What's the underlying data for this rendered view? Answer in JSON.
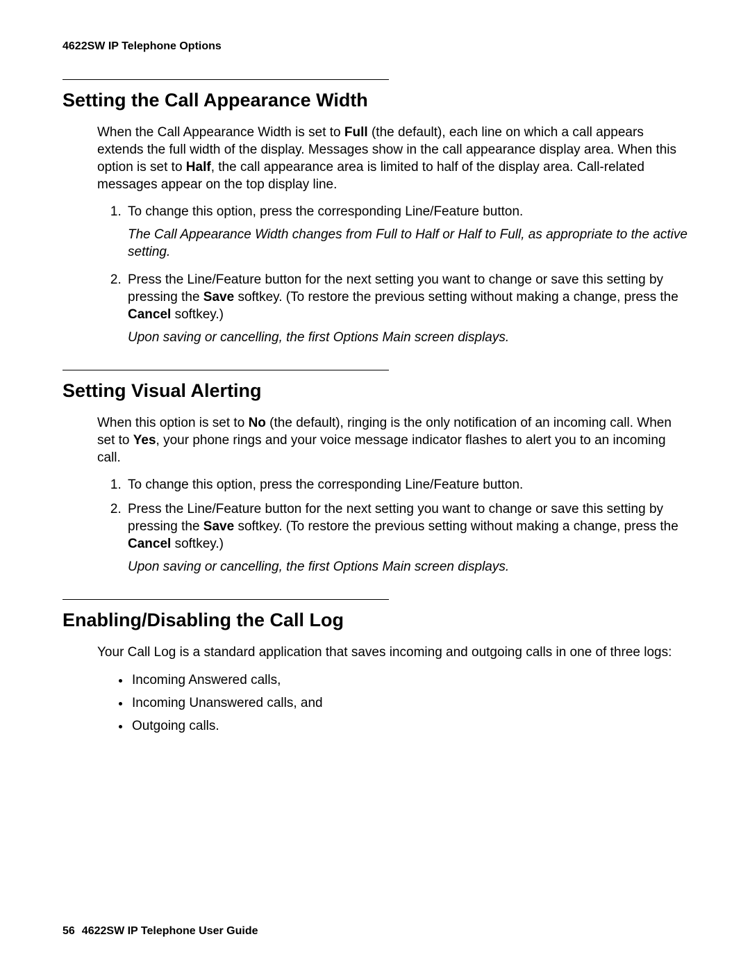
{
  "header": {
    "running": "4622SW IP Telephone Options"
  },
  "sections": {
    "s1": {
      "heading": "Setting the Call Appearance Width",
      "intro": {
        "pre1": "When the Call Appearance Width is set to ",
        "b1": "Full",
        "mid1": " (the default), each line on which a call appears extends the full width of the display. Messages show in the call appearance display area. When this option is set to ",
        "b2": "Half",
        "post1": ", the call appearance area is limited to half of the display area. Call-related messages appear on the top display line."
      },
      "step1": "To change this option, press the corresponding Line/Feature button.",
      "step1_result": "The Call Appearance Width changes from Full to Half or Half to Full, as appropriate to the active setting.",
      "step2": {
        "pre": "Press the Line/Feature button for the next setting you want to change or save this setting by pressing the ",
        "b1": "Save",
        "mid": " softkey. (To restore the previous setting without making a change, press the ",
        "b2": "Cancel",
        "post": " softkey.)"
      },
      "step2_result": "Upon saving or cancelling, the first Options Main screen displays."
    },
    "s2": {
      "heading": "Setting Visual Alerting",
      "intro": {
        "pre1": "When this option is set to ",
        "b1": "No",
        "mid1": " (the default), ringing is the only notification of an incoming call. When set to ",
        "b2": "Yes",
        "post1": ", your phone rings and your voice message indicator flashes to alert you to an incoming call."
      },
      "step1": "To change this option, press the corresponding Line/Feature button.",
      "step2": {
        "pre": "Press the Line/Feature button for the next setting you want to change or save this setting by pressing the ",
        "b1": "Save",
        "mid": " softkey. (To restore the previous setting without making a change, press the ",
        "b2": "Cancel",
        "post": " softkey.)"
      },
      "step2_result": "Upon saving or cancelling, the first Options Main screen displays."
    },
    "s3": {
      "heading": "Enabling/Disabling the Call Log",
      "intro": "Your Call Log is a standard application that saves incoming and outgoing calls in one of three logs:",
      "bullets": {
        "b1": "Incoming Answered calls,",
        "b2": "Incoming Unanswered calls, and",
        "b3": "Outgoing calls."
      }
    }
  },
  "footer": {
    "page": "56",
    "title": "4622SW IP Telephone User Guide"
  }
}
